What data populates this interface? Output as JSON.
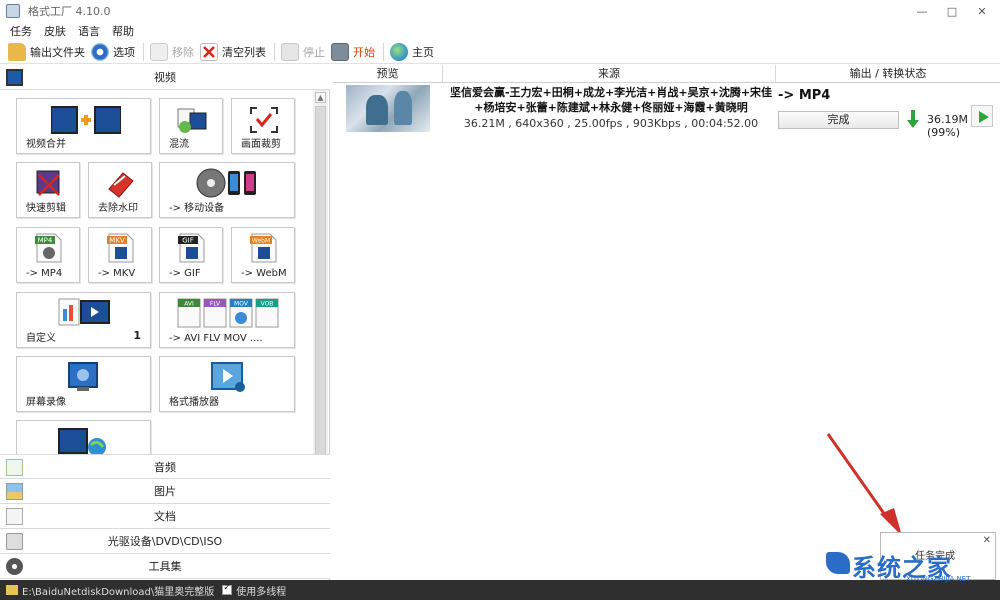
{
  "window": {
    "title": "格式工厂 4.10.0",
    "controls": [
      "—",
      "□",
      "✕"
    ]
  },
  "menu": [
    "任务",
    "皮肤",
    "语言",
    "帮助"
  ],
  "toolbar": {
    "output_folder": "输出文件夹",
    "options": "选项",
    "remove": "移除",
    "clear_list": "清空列表",
    "stop": "停止",
    "start": "开始",
    "home": "主页"
  },
  "left_panel": {
    "video_header": "视频",
    "tiles": [
      {
        "label": "视频合并",
        "badge": ""
      },
      {
        "label": "混流",
        "badge": ""
      },
      {
        "label": "画面裁剪",
        "badge": ""
      },
      {
        "label": "快速剪辑",
        "badge": ""
      },
      {
        "label": "去除水印",
        "badge": ""
      },
      {
        "label": "-> 移动设备",
        "badge": ""
      },
      {
        "label": "-> MP4",
        "badge": ""
      },
      {
        "label": "-> MKV",
        "badge": ""
      },
      {
        "label": "-> GIF",
        "badge": ""
      },
      {
        "label": "-> WebM",
        "badge": ""
      },
      {
        "label": "自定义",
        "badge": "1"
      },
      {
        "label": "-> AVI FLV MOV ....",
        "badge": ""
      },
      {
        "label": "屏幕录像",
        "badge": ""
      },
      {
        "label": "格式播放器",
        "badge": ""
      },
      {
        "label": "",
        "badge": ""
      }
    ],
    "tile_icon_text": {
      "mp4": "MP4",
      "mkv": "MKV",
      "gif": "GIF",
      "webm": "WebM",
      "avi": "AVI",
      "flv": "FLV",
      "mov": "MOV",
      "vob": "VOB"
    },
    "categories": [
      "音频",
      "图片",
      "文档",
      "光驱设备\\DVD\\CD\\ISO",
      "工具集"
    ]
  },
  "task_table": {
    "headers": [
      "预览",
      "来源",
      "输出 / 转换状态"
    ],
    "rows": [
      {
        "source_title": "坚信爱会赢-王力宏+田桐+成龙+李光洁+肖战+吴京+沈腾+宋佳+杨培安+张蕾+陈建斌+林永健+佟丽娅+海霞+黄晓明",
        "source_meta": "36.21M , 640x360 , 25.00fps , 903Kbps , 00:04:52.00",
        "output_format": "-> MP4",
        "status_button": "完成",
        "output_size": "36.19M",
        "output_percent": "(99%)"
      }
    ]
  },
  "statusbar": {
    "path": "E:\\BaiduNetdiskDownload\\猫里奥完整版",
    "multithread": "使用多线程",
    "multithread_checked": true
  },
  "notification": {
    "text": "任务完成",
    "close": "✕"
  },
  "watermark": {
    "main": "系统之家",
    "sub": "XITONGZHIJIA.NET"
  },
  "colors": {
    "accent_green": "#2fa43a",
    "start_red": "#d4400f",
    "annotation_red": "#d0302a",
    "status_dark": "#2f2f2f"
  }
}
